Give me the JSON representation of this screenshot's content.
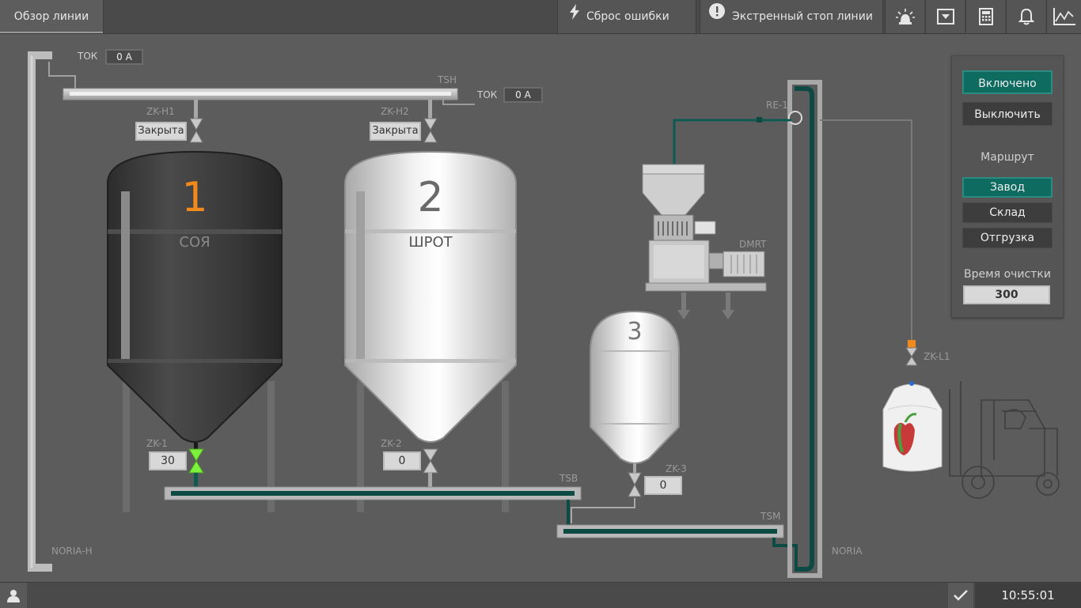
{
  "header": {
    "tab": "Обзор линии",
    "reset_error": "Сброс ошибки",
    "emergency_stop": "Экстренный стоп линии"
  },
  "status": {
    "time": "10:55:01"
  },
  "current": [
    {
      "label": "ТОК",
      "value": "0 A"
    },
    {
      "label": "ТОК",
      "value": "0 A"
    }
  ],
  "labels": {
    "tsh": "TSH",
    "zk_h1": "ZK-H1",
    "zk_h2": "ZK-H2",
    "re1": "RE-1",
    "dmrt": "DMRT",
    "zk1": "ZK-1",
    "zk2": "ZK-2",
    "zk3": "ZK-3",
    "tsb": "TSB",
    "tsm": "TSM",
    "noria_h": "NORIA-H",
    "noria": "NORIA",
    "zk_l1": "ZK-L1"
  },
  "valves_top": {
    "h1": "Закрыта",
    "h2": "Закрыта"
  },
  "valves_bottom": {
    "zk1": "30",
    "zk2": "0",
    "zk3": "0"
  },
  "tanks": [
    {
      "number": "1",
      "product": "СОЯ"
    },
    {
      "number": "2",
      "product": "ШРОТ"
    },
    {
      "number": "3"
    }
  ],
  "panel": {
    "on": "Включено",
    "off": "Выключить",
    "route_title": "Маршрут",
    "routes": [
      "Завод",
      "Склад",
      "Отгрузка"
    ],
    "clean_title": "Время очистки",
    "clean_value": "300"
  },
  "colors": {
    "accent": "#0d6b60",
    "tank1_number": "#f08a1c",
    "valve_open": "#7cf03c"
  }
}
